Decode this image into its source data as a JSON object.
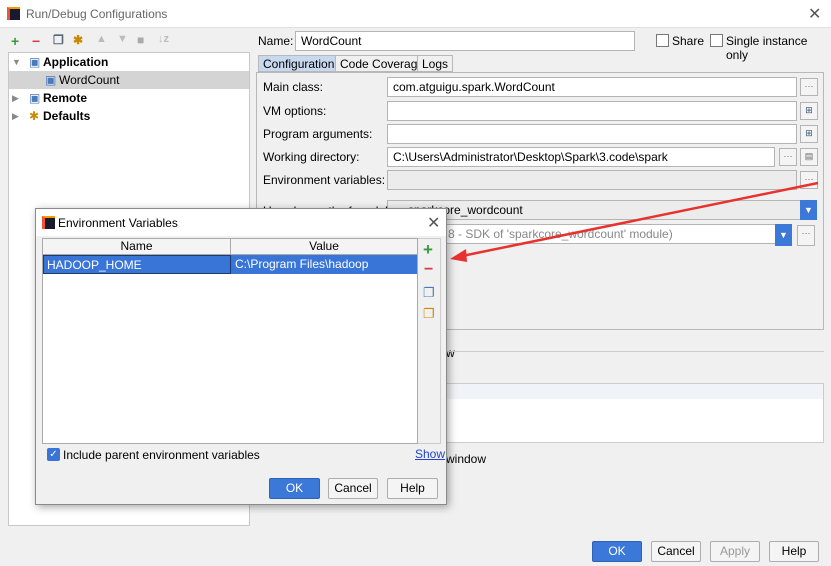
{
  "window": {
    "title": "Run/Debug Configurations"
  },
  "toolbar": {
    "icons": [
      "add-icon",
      "remove-icon",
      "copy-icon",
      "edit-defaults-icon",
      "move-up-icon",
      "move-down-icon",
      "folder-icon",
      "sort-icon"
    ]
  },
  "tree": {
    "items": [
      {
        "label": "Application",
        "expanded": true
      },
      {
        "label": "WordCount",
        "selected": true
      },
      {
        "label": "Remote",
        "expanded": false
      },
      {
        "label": "Defaults",
        "expanded": false
      }
    ]
  },
  "config": {
    "name_label": "Name:",
    "name_value": "WordCount",
    "share_label": "Share",
    "single_instance_label": "Single instance only",
    "tabs": [
      "Configuration",
      "Code Coverage",
      "Logs"
    ],
    "main_class_label": "Main class:",
    "main_class_value": "com.atguigu.spark.WordCount",
    "vm_options_label": "VM options:",
    "vm_options_value": "",
    "program_args_label": "Program arguments:",
    "program_args_value": "",
    "working_dir_label": "Working directory:",
    "working_dir_value": "C:\\Users\\Administrator\\Desktop\\Spark\\3.code\\spark",
    "env_vars_label": "Environment variables:",
    "env_vars_value": "",
    "classpath_label": "Use classpath of module:",
    "classpath_value": "sparkcore_wordcount",
    "jre_value": "8 - SDK of 'sparkcore_wordcount' module)",
    "before_launch_partial": "w",
    "window_partial": "window"
  },
  "buttons": {
    "ok": "OK",
    "cancel": "Cancel",
    "apply": "Apply",
    "help": "Help"
  },
  "env_dialog": {
    "title": "Environment Variables",
    "columns": [
      "Name",
      "Value"
    ],
    "rows": [
      {
        "name": "HADOOP_HOME",
        "value": "C:\\Program Files\\hadoop"
      }
    ],
    "include_parent_label": "Include parent environment variables",
    "include_parent_checked": true,
    "show_link": "Show",
    "ok": "OK",
    "cancel": "Cancel",
    "help": "Help"
  },
  "colors": {
    "accent": "#3b78d8",
    "selection": "#3875d7",
    "arrow": "#e8322e"
  }
}
